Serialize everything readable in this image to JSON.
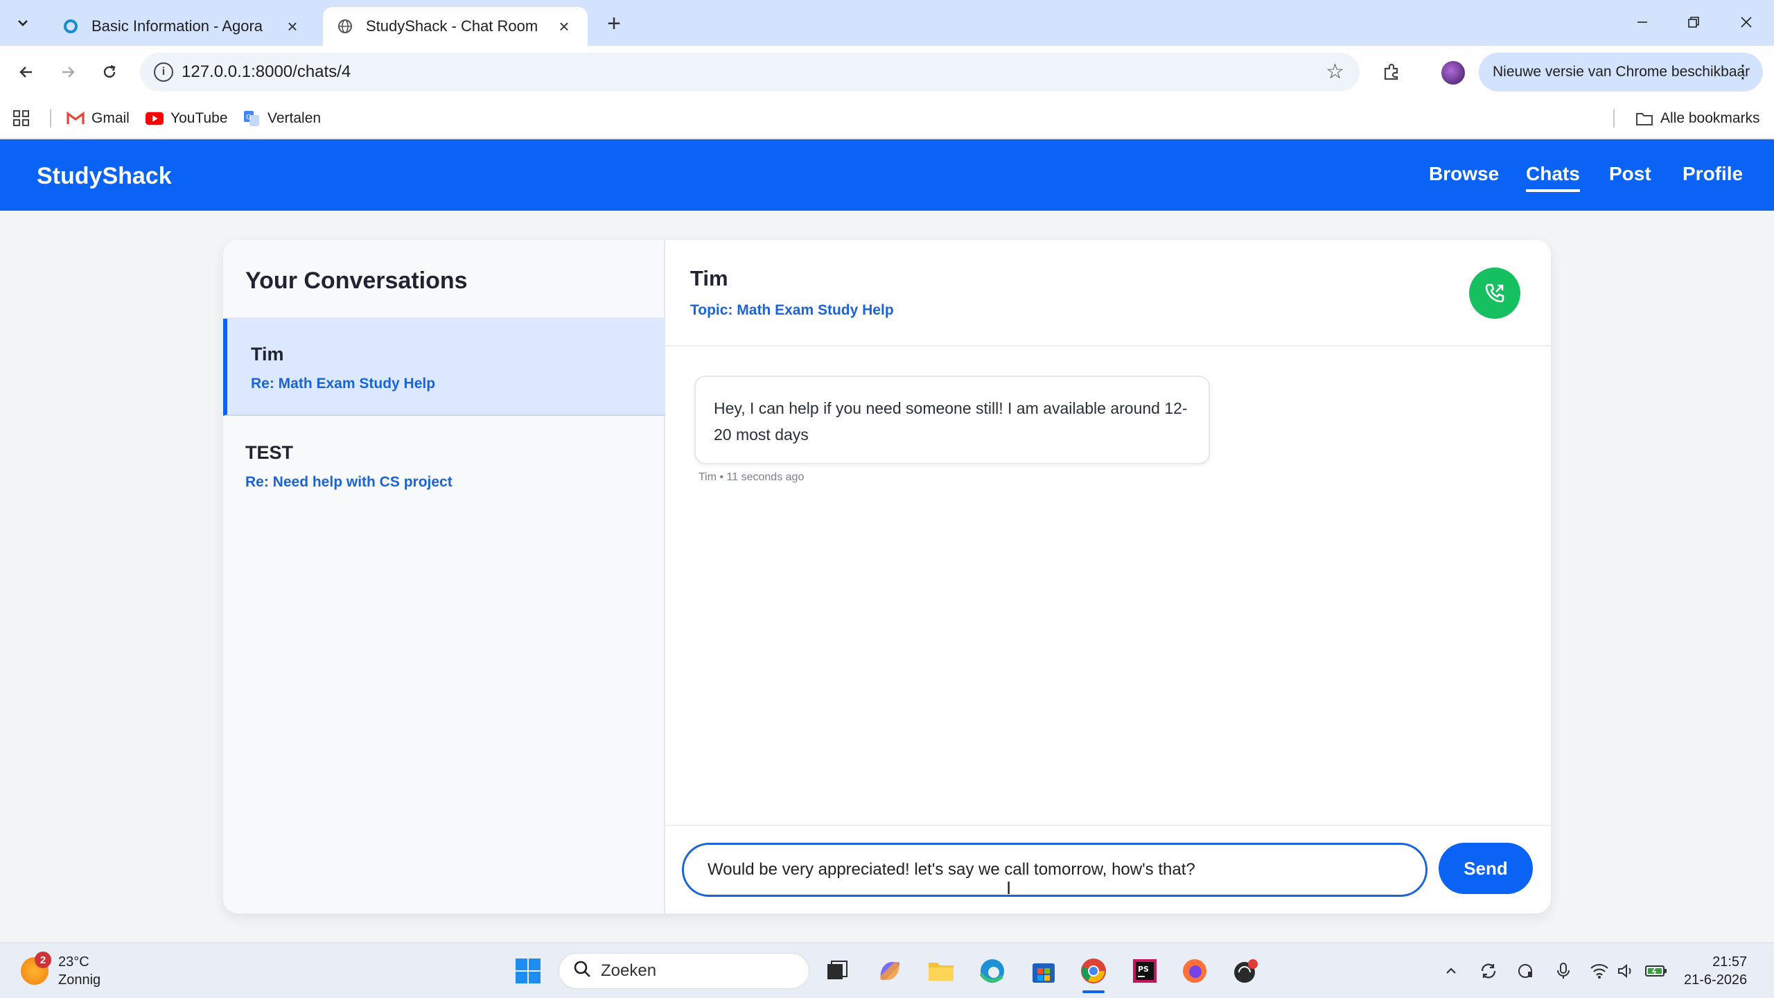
{
  "browser": {
    "tabs": [
      {
        "title": "Basic Information - Agora",
        "active": false
      },
      {
        "title": "StudyShack - Chat Room",
        "active": true
      }
    ],
    "url": "127.0.0.1:8000/chats/4",
    "update_label": "Nieuwe versie van Chrome beschikbaar",
    "bookmarks": [
      {
        "label": "Gmail",
        "icon": "gmail-icon"
      },
      {
        "label": "YouTube",
        "icon": "youtube-icon"
      },
      {
        "label": "Vertalen",
        "icon": "translate-icon"
      }
    ],
    "all_bookmarks_label": "Alle bookmarks"
  },
  "app": {
    "brand": "StudyShack",
    "nav": [
      {
        "label": "Browse",
        "active": false
      },
      {
        "label": "Chats",
        "active": true
      },
      {
        "label": "Post",
        "active": false
      },
      {
        "label": "Profile",
        "active": false
      }
    ],
    "accent_color": "#0b63f6"
  },
  "sidebar": {
    "title": "Your Conversations",
    "conversations": [
      {
        "name": "Tim",
        "topic": "Re: Math Exam Study Help",
        "active": true
      },
      {
        "name": "TEST",
        "topic": "Re: Need help with CS project",
        "active": false
      }
    ]
  },
  "chat": {
    "partner": "Tim",
    "topic": "Topic: Math Exam Study Help",
    "messages": [
      {
        "text": "Hey, I can help if you need someone still! I am available around 12-20 most days",
        "meta": "Tim • 11 seconds ago"
      }
    ],
    "input_value": "Would be very appreciated! let's say we call tomorrow, how's that?",
    "send_label": "Send",
    "call_color": "#16c060"
  },
  "taskbar": {
    "weather_temp": "23°C",
    "weather_desc": "Zonnig",
    "weather_badge": "2",
    "search_placeholder": "Zoeken",
    "time": "21:57",
    "date": "21-6-2026"
  }
}
